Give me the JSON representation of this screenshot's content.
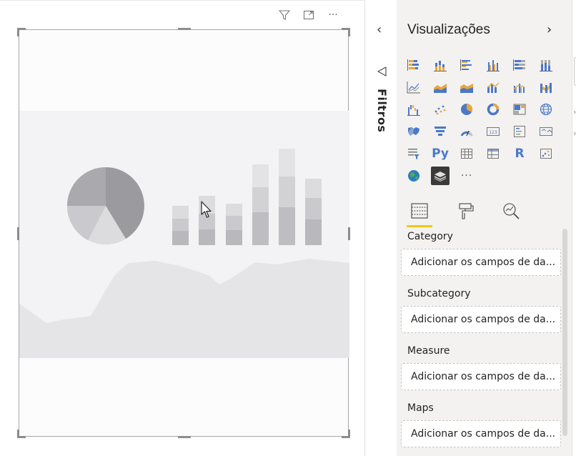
{
  "canvas": {
    "header_icons": [
      "filter-icon",
      "focus-mode-icon",
      "more-options-icon"
    ],
    "more_label": "···"
  },
  "filters": {
    "collapse_glyph": "‹",
    "label": "Filtros"
  },
  "visualizations": {
    "title": "Visualizações",
    "expand_glyph": "›",
    "icons": [
      "stacked-bar-chart-icon",
      "stacked-column-chart-icon",
      "clustered-bar-chart-icon",
      "clustered-column-chart-icon",
      "100-stacked-bar-chart-icon",
      "100-stacked-column-chart-icon",
      "line-chart-icon",
      "area-chart-icon",
      "stacked-area-chart-icon",
      "line-and-stacked-column-chart-icon",
      "line-and-clustered-column-chart-icon",
      "ribbon-chart-icon",
      "waterfall-chart-icon",
      "scatter-chart-icon",
      "pie-chart-icon",
      "donut-chart-icon",
      "treemap-icon",
      "map-icon",
      "filled-map-icon",
      "funnel-icon",
      "gauge-icon",
      "card-icon",
      "multi-row-card-icon",
      "kpi-icon",
      "slicer-icon",
      "python-visual-icon",
      "table-icon",
      "matrix-icon",
      "r-visual-icon",
      "key-influencers-icon",
      "arcgis-map-icon",
      "custom-visual-icon",
      "more-visuals-icon"
    ],
    "python_label": "Py",
    "r_label": "R",
    "more_label": "···",
    "selected_icon": "custom-visual-icon",
    "tabs": [
      "fields-tab-icon",
      "format-tab-icon",
      "analytics-tab-icon"
    ],
    "accent": "#f2c811",
    "wells": [
      {
        "label": "Category",
        "placeholder": "Adicionar os campos de da..."
      },
      {
        "label": "Subcategory",
        "placeholder": "Adicionar os campos de da..."
      },
      {
        "label": "Measure",
        "placeholder": "Adicionar os campos de da..."
      },
      {
        "label": "Maps",
        "placeholder": "Adicionar os campos de da..."
      }
    ]
  }
}
